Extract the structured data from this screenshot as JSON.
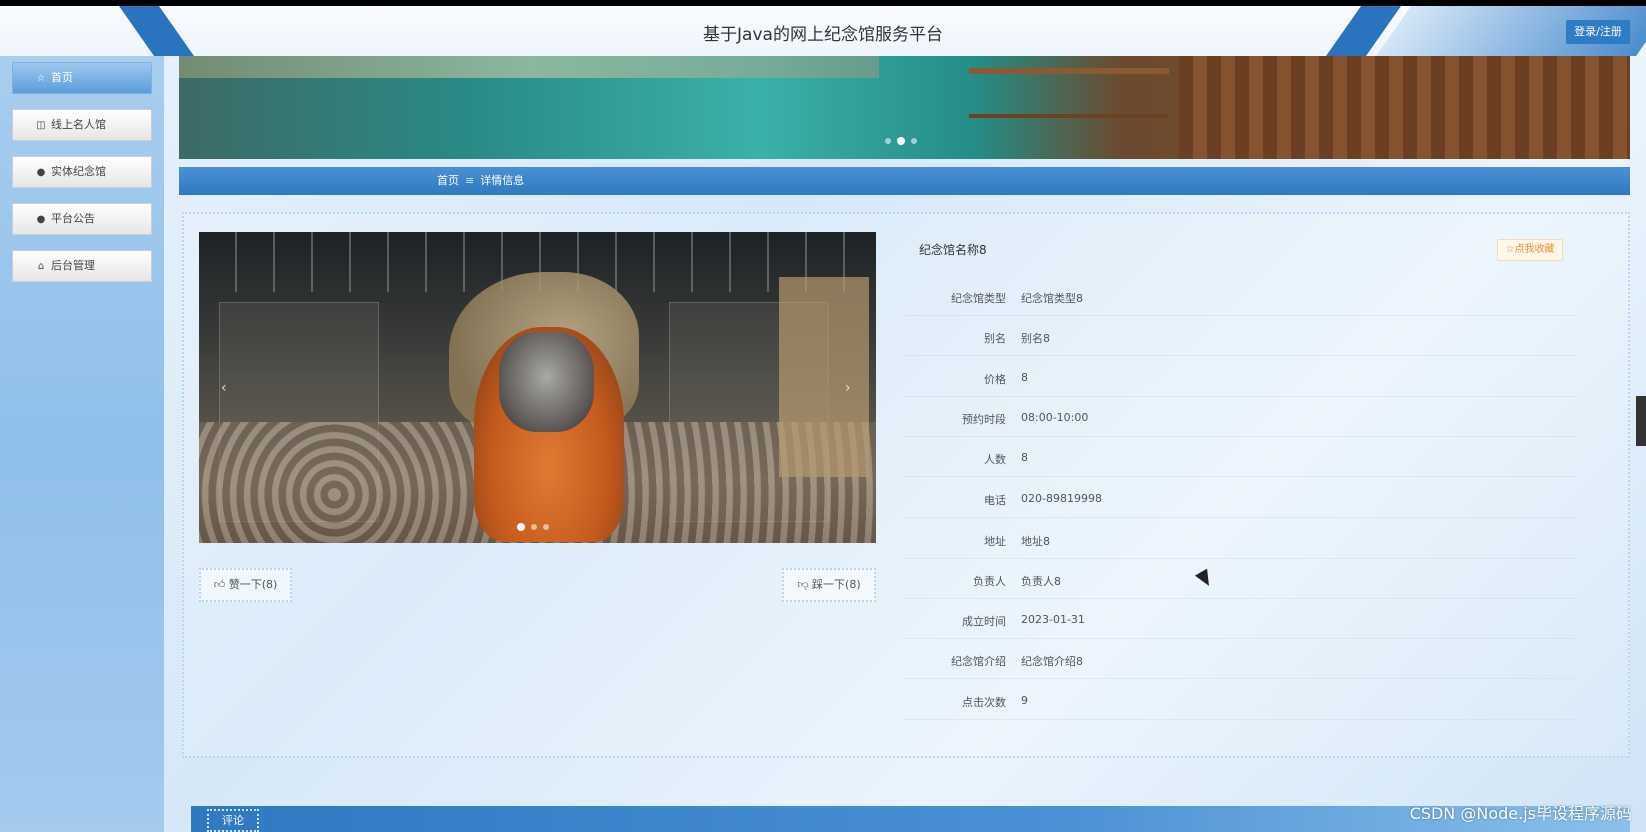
{
  "header": {
    "title": "基于Java的网上纪念馆服务平台",
    "login_label": "登录/注册"
  },
  "sidebar": {
    "items": [
      {
        "label": "首页",
        "icon": "star-icon",
        "active": true
      },
      {
        "label": "线上名人馆",
        "icon": "bag-icon",
        "active": false
      },
      {
        "label": "实体纪念馆",
        "icon": "info-icon",
        "active": false
      },
      {
        "label": "平台公告",
        "icon": "help-icon",
        "active": false
      },
      {
        "label": "后台管理",
        "icon": "shop-icon",
        "active": false
      }
    ]
  },
  "breadcrumb": {
    "home": "首页",
    "separator": "≡",
    "current": "详情信息"
  },
  "detail": {
    "name": "纪念馆名称8",
    "favorite_label": "☆点我收藏",
    "like_label": "赞一下(8)",
    "dislike_label": "踩一下(8)",
    "fields": [
      {
        "label": "纪念馆类型",
        "value": "纪念馆类型8"
      },
      {
        "label": "别名",
        "value": "别名8"
      },
      {
        "label": "价格",
        "value": "8"
      },
      {
        "label": "预约时段",
        "value": "08:00-10:00"
      },
      {
        "label": "人数",
        "value": "8"
      },
      {
        "label": "电话",
        "value": "020-89819998"
      },
      {
        "label": "地址",
        "value": "地址8"
      },
      {
        "label": "负责人",
        "value": "负责人8"
      },
      {
        "label": "成立时间",
        "value": "2023-01-31"
      },
      {
        "label": "纪念馆介绍",
        "value": "纪念馆介绍8"
      },
      {
        "label": "点击次数",
        "value": "9"
      }
    ]
  },
  "comment": {
    "tab_label": "评论"
  },
  "watermark": "CSDN @Node.js毕设程序源码",
  "colors": {
    "primary": "#2f79c2",
    "sidebar": "#9ec8ef",
    "favorite": "#e8912e"
  }
}
